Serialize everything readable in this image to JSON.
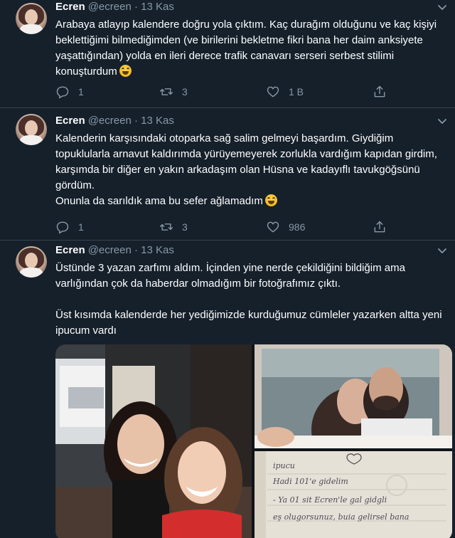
{
  "colors": {
    "background": "#15202b",
    "divider": "#38444d",
    "text_primary": "#ffffff",
    "text_secondary": "#8899a6"
  },
  "tweets": [
    {
      "name": "Ecren",
      "handle": "@ecreen · 13 Kas",
      "text": "Arabaya atlayıp kalendere doğru yola çıktım. Kaç durağım olduğunu ve kaç kişiyi beklettiğimi bilmediğimden (ve birilerini bekletme fikri bana her daim anksiyete yaşattığından) yolda en ileri derece trafik canavarı serseri serbest stilimi konuşturdum",
      "emoji": "laughing-tears-emoji",
      "replies": "1",
      "retweets": "3",
      "likes": "1 B"
    },
    {
      "name": "Ecren",
      "handle": "@ecreen · 13 Kas",
      "text": "Kalenderin karşısındaki otoparka sağ salim gelmeyi başardım. Giydiğim topuklularla arnavut kaldırımda yürüyemeyerek zorlukla vardığım kapıdan girdim, karşımda bir diğer en yakın arkadaşım olan Hüsna ve kadayıflı tavukgöğsünü gördüm.",
      "text2": "Onunla da sarıldık ama bu sefer ağlamadım",
      "emoji": "laughing-tears-emoji",
      "replies": "1",
      "retweets": "3",
      "likes": "986"
    },
    {
      "name": "Ecren",
      "handle": "@ecreen · 13 Kas",
      "text": "Üstünde 3 yazan zarfımı aldım. İçinden yine nerde çekildiğini bildiğim ama varlığından çok da haberdar olmadığım bir fotoğrafımız çıktı.",
      "text2": "Üst kısımda kalenderde her yediğimizde kurduğumuz cümleler yazarken altta yeni ipucum vardı",
      "photo_note_lines": [
        "ipucu",
        "Hadi 101'e gidelim",
        "- Ya 01 sit Ecren'le gal gidgli",
        "eş olugorsunuz, buia gelirsel bana"
      ]
    }
  ]
}
